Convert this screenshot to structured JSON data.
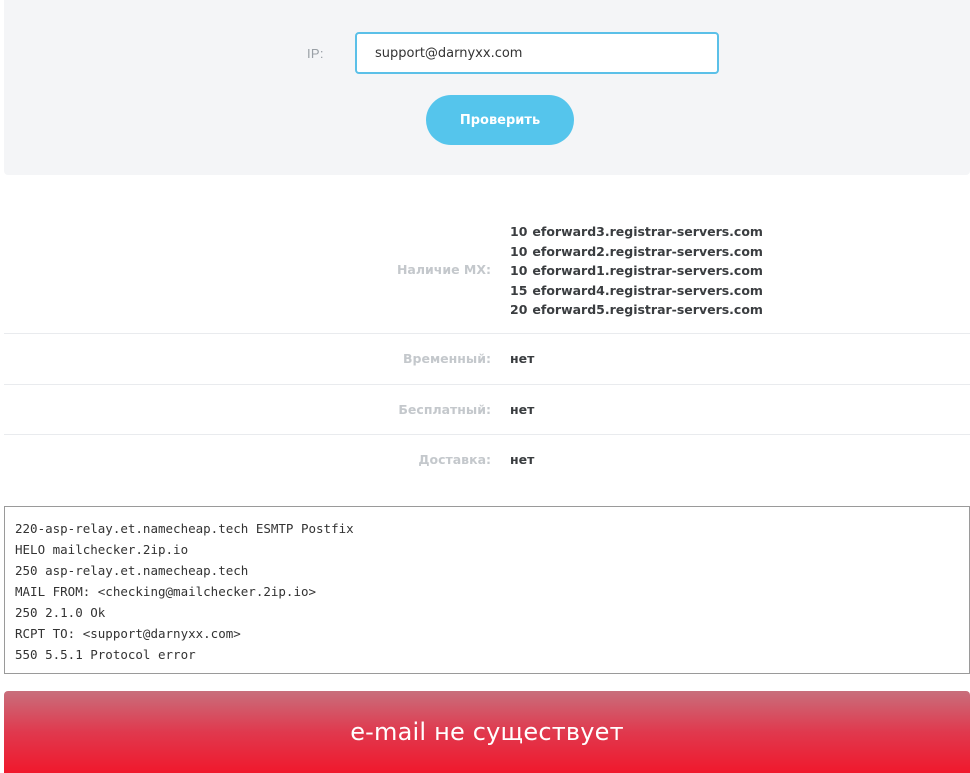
{
  "form": {
    "ip_label": "IP:",
    "input_value": "support@darnyxx.com",
    "check_button_label": "Проверить"
  },
  "results": {
    "mx": {
      "label": "Наличие MX:",
      "records": [
        {
          "priority": "10",
          "host": "eforward3.registrar-servers.com"
        },
        {
          "priority": "10",
          "host": "eforward2.registrar-servers.com"
        },
        {
          "priority": "10",
          "host": "eforward1.registrar-servers.com"
        },
        {
          "priority": "15",
          "host": "eforward4.registrar-servers.com"
        },
        {
          "priority": "20",
          "host": "eforward5.registrar-servers.com"
        }
      ]
    },
    "temporary": {
      "label": "Временный:",
      "value": "нет"
    },
    "free": {
      "label": "Бесплатный:",
      "value": "нет"
    },
    "delivery": {
      "label": "Доставка:",
      "value": "нет"
    }
  },
  "smtp_log": [
    "220-asp-relay.et.namecheap.tech ESMTP Postfix",
    "HELO mailchecker.2ip.io",
    "250 asp-relay.et.namecheap.tech",
    "MAIL FROM: <checking@mailchecker.2ip.io>",
    "250 2.1.0 Ok",
    "RCPT TO: <support@darnyxx.com>",
    "550 5.5.1 Protocol error"
  ],
  "status": {
    "text": "e-mail не существует",
    "color": "#f0182c"
  },
  "colors": {
    "accent": "#55c5ec",
    "panel_bg": "#f4f5f7"
  }
}
